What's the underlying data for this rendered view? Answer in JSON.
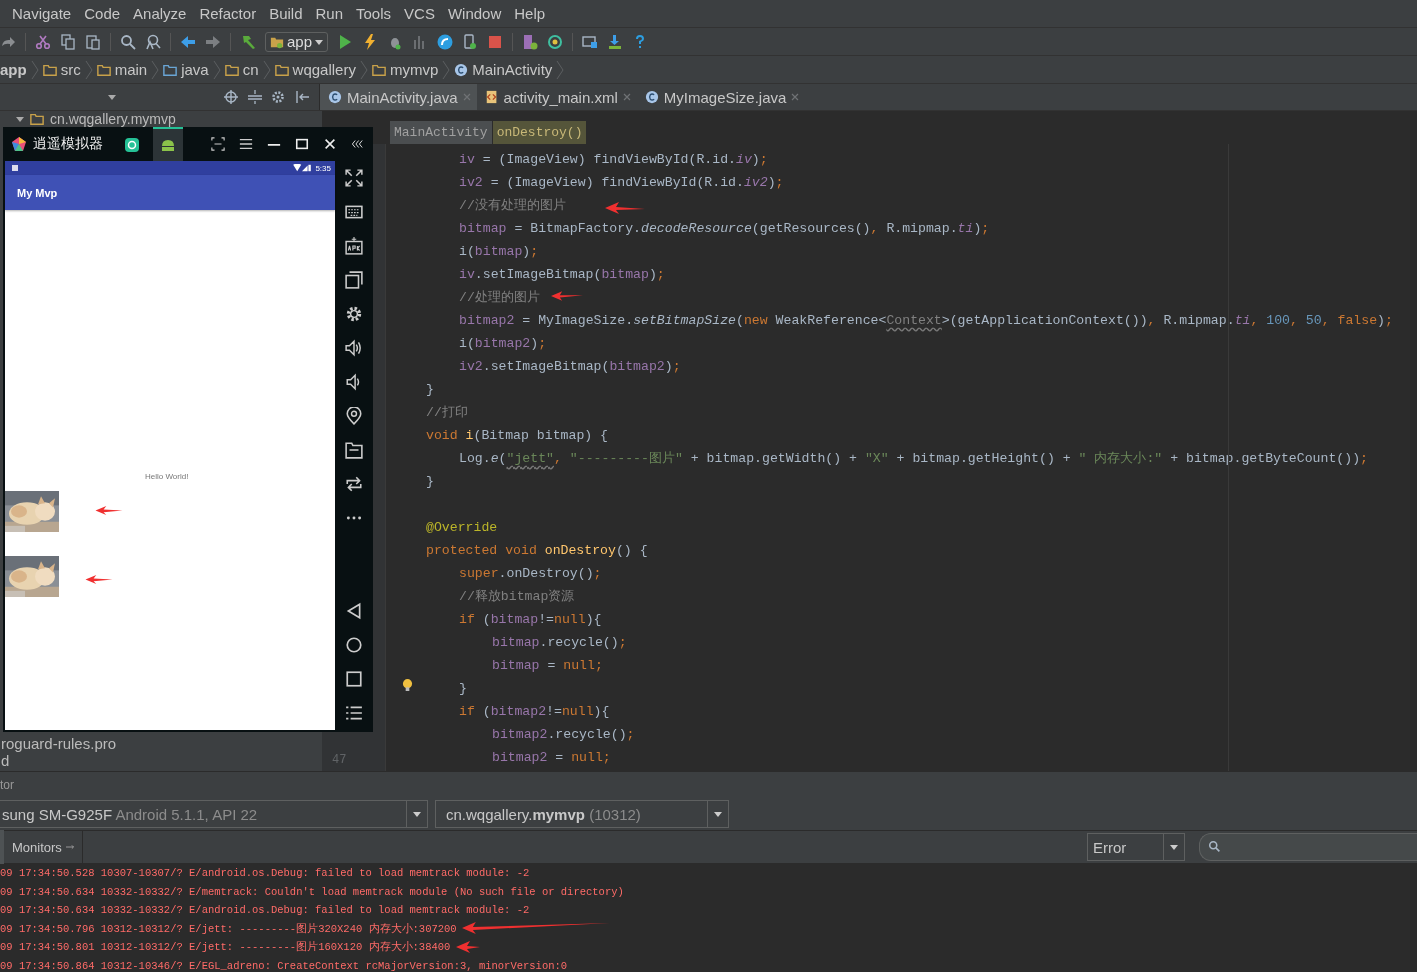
{
  "menu": [
    "Navigate",
    "Code",
    "Analyze",
    "Refactor",
    "Build",
    "Run",
    "Tools",
    "VCS",
    "Window",
    "Help"
  ],
  "toolbar": {
    "config": "app"
  },
  "breadcrumbs": [
    {
      "label": "app",
      "kind": "module"
    },
    {
      "label": "src",
      "kind": "folder"
    },
    {
      "label": "main",
      "kind": "folder"
    },
    {
      "label": "java",
      "kind": "source"
    },
    {
      "label": "cn",
      "kind": "package"
    },
    {
      "label": "wqgallery",
      "kind": "package"
    },
    {
      "label": "mymvp",
      "kind": "package"
    },
    {
      "label": "MainActivity",
      "kind": "class"
    }
  ],
  "editor_tabs": [
    {
      "label": "MainActivity.java",
      "kind": "class",
      "selected": true
    },
    {
      "label": "activity_main.xml",
      "kind": "xml",
      "selected": false
    },
    {
      "label": "MyImageSize.java",
      "kind": "class",
      "selected": false
    }
  ],
  "project_tree": {
    "items": [
      "cn.wqgallery.mymvp",
      "roguard-rules.pro",
      "d"
    ]
  },
  "editor": {
    "path": [
      "MainActivity",
      "onDestroy()"
    ],
    "line_number": "47",
    "lines": [
      {
        "kind": "block",
        "children": [
          {
            "kind": "line",
            "tokens": [
              {
                "text": "iv",
                "kind": "field"
              },
              {
                "text": " = (ImageView) findViewById(R.id.",
                "kind": "plain"
              },
              {
                "text": "iv",
                "kind": "sfield"
              },
              {
                "text": ")",
                "kind": "plain"
              },
              {
                "text": ";",
                "kind": "kw"
              }
            ]
          },
          {
            "kind": "line",
            "tokens": [
              {
                "text": "iv2",
                "kind": "field"
              },
              {
                "text": " = (ImageView) findViewById(R.id.",
                "kind": "plain"
              },
              {
                "text": "iv2",
                "kind": "sfield"
              },
              {
                "text": ")",
                "kind": "plain"
              },
              {
                "text": ";",
                "kind": "kw"
              }
            ]
          },
          {
            "kind": "line",
            "tokens": [
              {
                "text": "//没有处理的图片",
                "kind": "comment"
              }
            ]
          },
          {
            "kind": "line",
            "tokens": [
              {
                "text": "bitmap",
                "kind": "field"
              },
              {
                "text": " = BitmapFactory.",
                "kind": "plain"
              },
              {
                "text": "decodeResource",
                "kind": "smethod"
              },
              {
                "text": "(getResources()",
                "kind": "plain"
              },
              {
                "text": ", ",
                "kind": "kw"
              },
              {
                "text": "R.mipmap.",
                "kind": "plain"
              },
              {
                "text": "ti",
                "kind": "sfield"
              },
              {
                "text": ")",
                "kind": "plain"
              },
              {
                "text": ";",
                "kind": "kw"
              }
            ]
          },
          {
            "kind": "line",
            "tokens": [
              {
                "text": "i(",
                "kind": "plain"
              },
              {
                "text": "bitmap",
                "kind": "field"
              },
              {
                "text": ")",
                "kind": "plain"
              },
              {
                "text": ";",
                "kind": "kw"
              }
            ]
          },
          {
            "kind": "line",
            "tokens": [
              {
                "text": "iv",
                "kind": "field"
              },
              {
                "text": ".setImageBitmap(",
                "kind": "plain"
              },
              {
                "text": "bitmap",
                "kind": "field"
              },
              {
                "text": ")",
                "kind": "plain"
              },
              {
                "text": ";",
                "kind": "kw"
              }
            ]
          },
          {
            "kind": "line",
            "tokens": [
              {
                "text": "//处理的图片",
                "kind": "comment"
              }
            ]
          },
          {
            "kind": "line",
            "tokens": [
              {
                "text": "bitmap2",
                "kind": "field"
              },
              {
                "text": " = MyImageSize.",
                "kind": "plain"
              },
              {
                "text": "setBitmapSize",
                "kind": "smethod"
              },
              {
                "text": "(",
                "kind": "plain"
              },
              {
                "text": "new ",
                "kind": "kw"
              },
              {
                "text": "WeakReference<",
                "kind": "plain"
              },
              {
                "text": "Context",
                "kind": "warn"
              },
              {
                "text": ">(getApplicationContext())",
                "kind": "plain"
              },
              {
                "text": ", ",
                "kind": "kw"
              },
              {
                "text": "R.mipmap.",
                "kind": "plain"
              },
              {
                "text": "ti",
                "kind": "sfield"
              },
              {
                "text": ", ",
                "kind": "kw"
              },
              {
                "text": "100",
                "kind": "num"
              },
              {
                "text": ", ",
                "kind": "kw"
              },
              {
                "text": "50",
                "kind": "num"
              },
              {
                "text": ", ",
                "kind": "kw"
              },
              {
                "text": "false",
                "kind": "kw"
              },
              {
                "text": ")",
                "kind": "plain"
              },
              {
                "text": ";",
                "kind": "kw"
              }
            ]
          },
          {
            "kind": "line",
            "tokens": [
              {
                "text": "i(",
                "kind": "plain"
              },
              {
                "text": "bitmap2",
                "kind": "field"
              },
              {
                "text": ")",
                "kind": "plain"
              },
              {
                "text": ";",
                "kind": "kw"
              }
            ]
          },
          {
            "kind": "line",
            "tokens": [
              {
                "text": "iv2",
                "kind": "field"
              },
              {
                "text": ".setImageBitmap(",
                "kind": "plain"
              },
              {
                "text": "bitmap2",
                "kind": "field"
              },
              {
                "text": ")",
                "kind": "plain"
              },
              {
                "text": ";",
                "kind": "kw"
              }
            ]
          }
        ]
      },
      {
        "kind": "line",
        "tokens": [
          {
            "text": "}",
            "kind": "plain"
          }
        ]
      },
      {
        "kind": "line",
        "tokens": [
          {
            "text": "//打印",
            "kind": "comment"
          }
        ]
      },
      {
        "kind": "line",
        "tokens": [
          {
            "text": "void ",
            "kind": "kw"
          },
          {
            "text": "i",
            "kind": "decl"
          },
          {
            "text": "(Bitmap bitmap) {",
            "kind": "plain"
          }
        ],
        "children": [
          {
            "kind": "line",
            "tokens": [
              {
                "text": "Log.",
                "kind": "plain"
              },
              {
                "text": "e",
                "kind": "smethod"
              },
              {
                "text": "(",
                "kind": "plain"
              },
              {
                "text": "\"jett\"",
                "kind": "strwarn"
              },
              {
                "text": ", ",
                "kind": "kw"
              },
              {
                "text": "\"---------图片\"",
                "kind": "str"
              },
              {
                "text": " + bitmap.getWidth() + ",
                "kind": "plain"
              },
              {
                "text": "\"X\"",
                "kind": "str"
              },
              {
                "text": " + bitmap.getHeight() + ",
                "kind": "plain"
              },
              {
                "text": "\" 内存大小:\"",
                "kind": "str"
              },
              {
                "text": " + bitmap.getByteCount())",
                "kind": "plain"
              },
              {
                "text": ";",
                "kind": "kw"
              }
            ]
          }
        ]
      },
      {
        "kind": "line",
        "tokens": [
          {
            "text": "}",
            "kind": "plain"
          }
        ]
      },
      {
        "kind": "blank"
      },
      {
        "kind": "line",
        "tokens": [
          {
            "text": "@Override",
            "kind": "anno"
          }
        ]
      },
      {
        "kind": "line",
        "tokens": [
          {
            "text": "protected void ",
            "kind": "kw"
          },
          {
            "text": "onDestroy",
            "kind": "decl"
          },
          {
            "text": "() {",
            "kind": "plain"
          }
        ],
        "children": [
          {
            "kind": "line",
            "tokens": [
              {
                "text": "super",
                "kind": "kw"
              },
              {
                "text": ".onDestroy()",
                "kind": "plain"
              },
              {
                "text": ";",
                "kind": "kw"
              }
            ]
          },
          {
            "kind": "line",
            "tokens": [
              {
                "text": "//释放bitmap资源",
                "kind": "comment"
              }
            ]
          },
          {
            "kind": "line",
            "tokens": [
              {
                "text": "if ",
                "kind": "kw"
              },
              {
                "text": "(",
                "kind": "plain"
              },
              {
                "text": "bitmap",
                "kind": "field"
              },
              {
                "text": "!=",
                "kind": "plain"
              },
              {
                "text": "null",
                "kind": "kw"
              },
              {
                "text": "){",
                "kind": "plain"
              }
            ],
            "children": [
              {
                "kind": "line",
                "tokens": [
                  {
                    "text": "bitmap",
                    "kind": "field"
                  },
                  {
                    "text": ".recycle()",
                    "kind": "plain"
                  },
                  {
                    "text": ";",
                    "kind": "kw"
                  }
                ]
              },
              {
                "kind": "line",
                "tokens": [
                  {
                    "text": "bitmap",
                    "kind": "field"
                  },
                  {
                    "text": " = ",
                    "kind": "plain"
                  },
                  {
                    "text": "null",
                    "kind": "kw"
                  },
                  {
                    "text": ";",
                    "kind": "kw"
                  }
                ]
              }
            ]
          },
          {
            "kind": "line",
            "tokens": [
              {
                "text": "}",
                "kind": "plain"
              }
            ]
          },
          {
            "kind": "line",
            "tokens": [
              {
                "text": "if ",
                "kind": "kw"
              },
              {
                "text": "(",
                "kind": "plain"
              },
              {
                "text": "bitmap2",
                "kind": "field"
              },
              {
                "text": "!=",
                "kind": "plain"
              },
              {
                "text": "null",
                "kind": "kw"
              },
              {
                "text": "){",
                "kind": "plain"
              }
            ],
            "children": [
              {
                "kind": "line",
                "tokens": [
                  {
                    "text": "bitmap2",
                    "kind": "field"
                  },
                  {
                    "text": ".recycle()",
                    "kind": "plain"
                  },
                  {
                    "text": ";",
                    "kind": "kw"
                  }
                ]
              },
              {
                "kind": "line",
                "tokens": [
                  {
                    "text": "bitmap2",
                    "kind": "field"
                  },
                  {
                    "text": " = ",
                    "kind": "plain"
                  },
                  {
                    "text": "null",
                    "kind": "kw"
                  },
                  {
                    "text": ";",
                    "kind": "kw"
                  }
                ]
              }
            ]
          }
        ]
      }
    ]
  },
  "emulator": {
    "title": "逍遥模拟器",
    "tabs": [
      {
        "kind": "app",
        "selected": false
      },
      {
        "kind": "android",
        "selected": true
      }
    ],
    "phone": {
      "time": "5:35",
      "app_title": "My Mvp",
      "text": "Hello World!"
    }
  },
  "bottom_panel": {
    "title": "tor",
    "device": {
      "name": "sung SM-G925F",
      "detail": "Android 5.1.1, API 22"
    },
    "process": {
      "name": "cn.wqgallery.**mymvp**",
      "detail": "(10312)"
    },
    "tab": "Monitors",
    "level_filter": "Error",
    "log": [
      "09 17:34:50.528 10307-10307/? E/android.os.Debug: failed to load memtrack module: -2",
      "09 17:34:50.634 10332-10332/? E/memtrack: Couldn't load memtrack module (No such file or directory)",
      "09 17:34:50.634 10332-10332/? E/android.os.Debug: failed to load memtrack module: -2",
      "09 17:34:50.796 10312-10312/? E/jett: ---------图片320X240 内存大小:307200",
      "09 17:34:50.801 10312-10312/? E/jett: ---------图片160X120 内存大小:38400",
      "09 17:34:50.864 10312-10346/? E/EGL_adreno: CreateContext rcMajorVersion:3, minorVersion:0"
    ]
  }
}
